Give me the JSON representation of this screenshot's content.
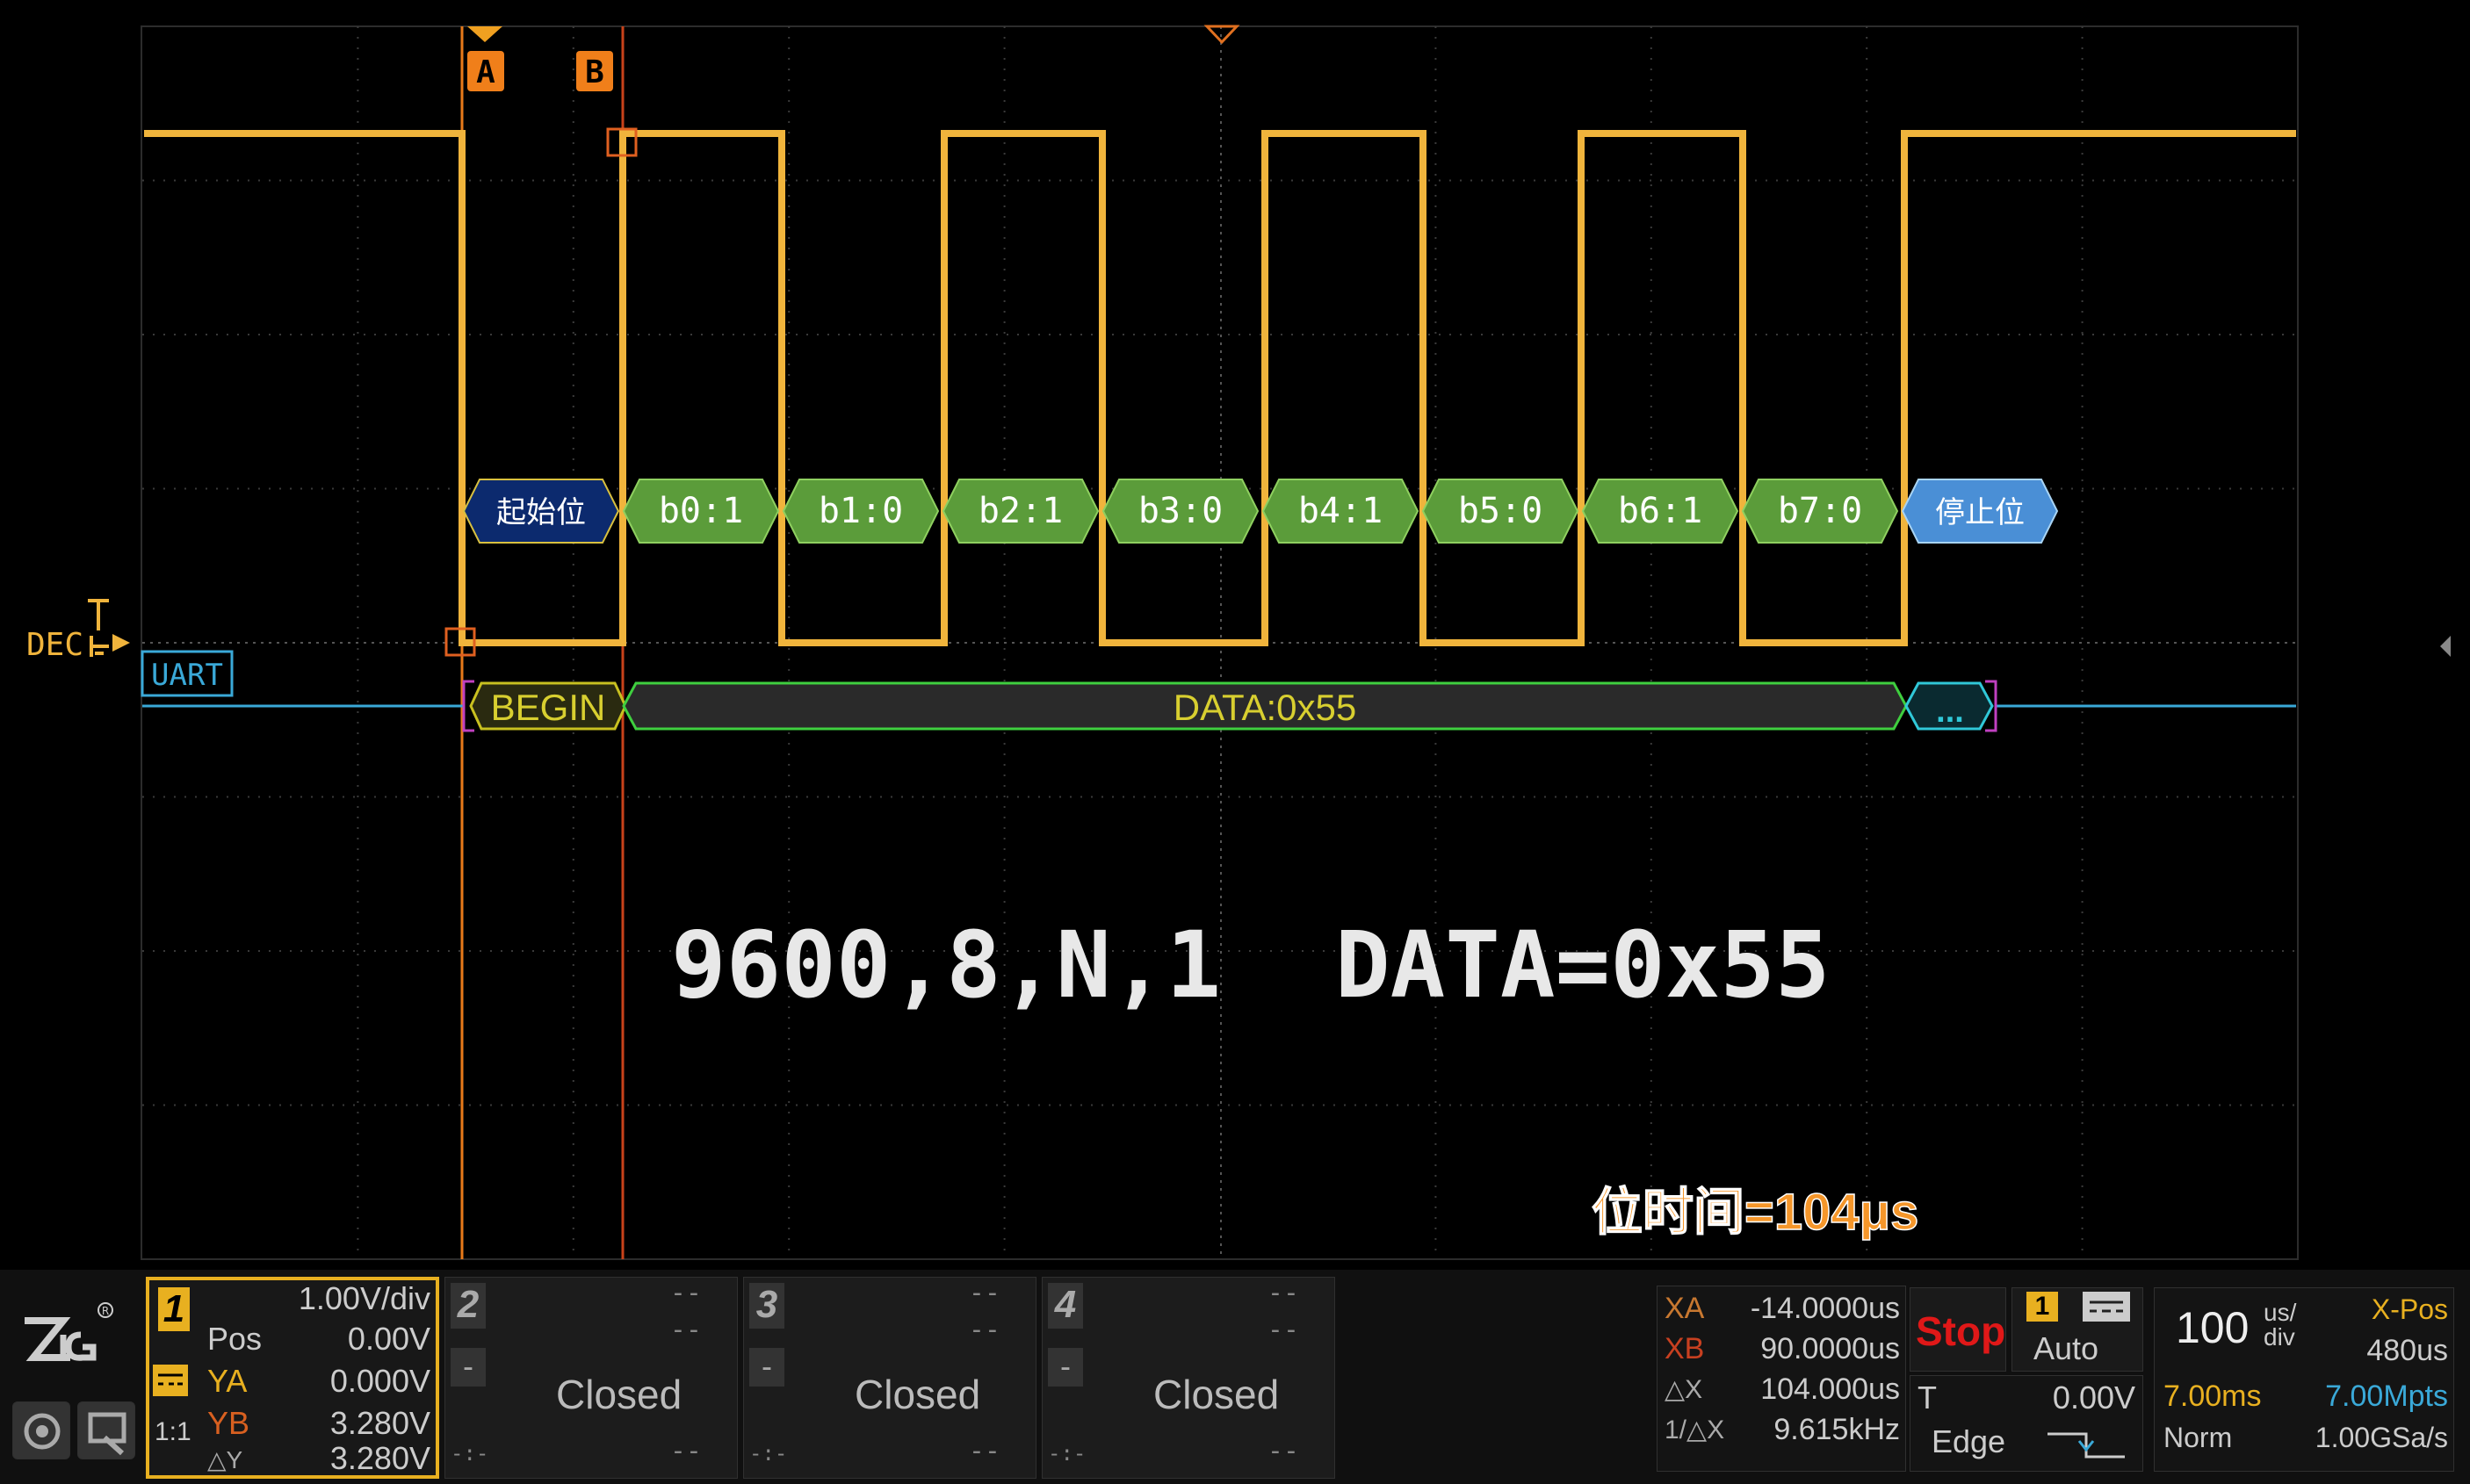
{
  "cursors": {
    "a_label": "A",
    "b_label": "B"
  },
  "channel_tag": "DEC",
  "decode_tag": "UART",
  "bits": [
    {
      "label": "起始位",
      "kind": "start"
    },
    {
      "label": "b0:1",
      "kind": "data"
    },
    {
      "label": "b1:0",
      "kind": "data"
    },
    {
      "label": "b2:1",
      "kind": "data"
    },
    {
      "label": "b3:0",
      "kind": "data"
    },
    {
      "label": "b4:1",
      "kind": "data"
    },
    {
      "label": "b5:0",
      "kind": "data"
    },
    {
      "label": "b6:1",
      "kind": "data"
    },
    {
      "label": "b7:0",
      "kind": "data"
    },
    {
      "label": "停止位",
      "kind": "stop"
    }
  ],
  "decode_bar": {
    "begin": "BEGIN",
    "data": "DATA:0x55",
    "more": "..."
  },
  "annotation": {
    "config": "9600,8,N,1",
    "data": "DATA=0x55",
    "bit_time": "位时间=104μs"
  },
  "colors": {
    "signal": "#f0b43c",
    "decode_line": "#3aa9d8",
    "start_fill": "#0c2a6e",
    "data_fill": "#5b9c3a",
    "stop_fill": "#4a8fd6",
    "decode_green": "#3fcf3f"
  },
  "bottom": {
    "ch1": {
      "num": "1",
      "scale": "1.00V/div",
      "pos_label": "Pos",
      "pos_value": "0.00V",
      "ya_label": "YA",
      "ya_value": "0.000V",
      "yb_label": "YB",
      "yb_value": "3.280V",
      "dy_label": "△Y",
      "dy_value": "3.280V",
      "coupling": "1:1"
    },
    "ch2": {
      "num": "2",
      "status": "Closed",
      "dash": "--",
      "minus": "-",
      "small": "-:-"
    },
    "ch3": {
      "num": "3",
      "status": "Closed",
      "dash": "--",
      "minus": "-",
      "small": "-:-"
    },
    "ch4": {
      "num": "4",
      "status": "Closed",
      "dash": "--",
      "minus": "-",
      "small": "-:-"
    },
    "cursor_meas": {
      "xa_label": "XA",
      "xa_value": "-14.0000us",
      "xb_label": "XB",
      "xb_value": "90.0000us",
      "dx_label": "△X",
      "dx_value": "104.000us",
      "inv_label": "1/△X",
      "inv_value": "9.615kHz"
    },
    "run": {
      "state": "Stop"
    },
    "trigger": {
      "source": "1",
      "mode": "Auto",
      "t_label": "T",
      "level": "0.00V",
      "type": "Edge"
    },
    "timebase": {
      "value": "100",
      "unit_top": "us/",
      "unit_bot": "div",
      "xpos_label": "X-Pos",
      "xpos_value": "480us",
      "window": "7.00ms",
      "memory": "7.00Mpts",
      "acq_mode": "Norm",
      "rate": "1.00GSa/s"
    }
  }
}
